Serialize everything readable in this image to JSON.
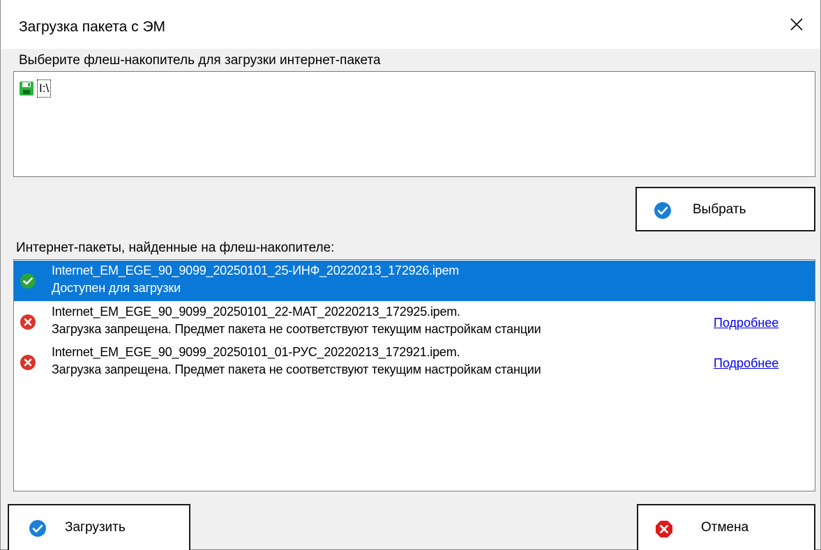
{
  "window": {
    "title": "Загрузка пакета с ЭМ"
  },
  "drive_section": {
    "label": "Выберите флеш-накопитель для загрузки интернет-пакета",
    "drives": [
      {
        "label": "I:\\",
        "icon": "floppy-disk-icon"
      }
    ]
  },
  "select_button": {
    "label": "Выбрать",
    "icon": "check-circle-icon"
  },
  "packages_section": {
    "label": "Интернет-пакеты, найденные на флеш-накопителе:",
    "items": [
      {
        "name": "Internet_EM_EGE_90_9099_20250101_25-ИНФ_20220213_172926.ipem",
        "status": "Доступен для загрузки",
        "state": "ok",
        "selected": true,
        "more": ""
      },
      {
        "name": "Internet_EM_EGE_90_9099_20250101_22-МАТ_20220213_172925.ipem.",
        "status": "Загрузка запрещена. Предмет пакета не соответствуют текущим настройкам станции",
        "state": "error",
        "selected": false,
        "more": "Подробнее"
      },
      {
        "name": "Internet_EM_EGE_90_9099_20250101_01-РУС_20220213_172921.ipem.",
        "status": "Загрузка запрещена. Предмет пакета не соответствуют текущим настройкам станции",
        "state": "error",
        "selected": false,
        "more": "Подробнее"
      }
    ]
  },
  "load_button": {
    "label": "Загрузить",
    "icon": "check-circle-icon"
  },
  "cancel_button": {
    "label": "Отмена",
    "icon": "error-octagon-icon"
  },
  "colors": {
    "selection": "#0a78d7",
    "accent_blue": "#1a7fd6",
    "ok_green": "#2aa53a",
    "error_red": "#d9342b",
    "link": "#0000ee"
  }
}
